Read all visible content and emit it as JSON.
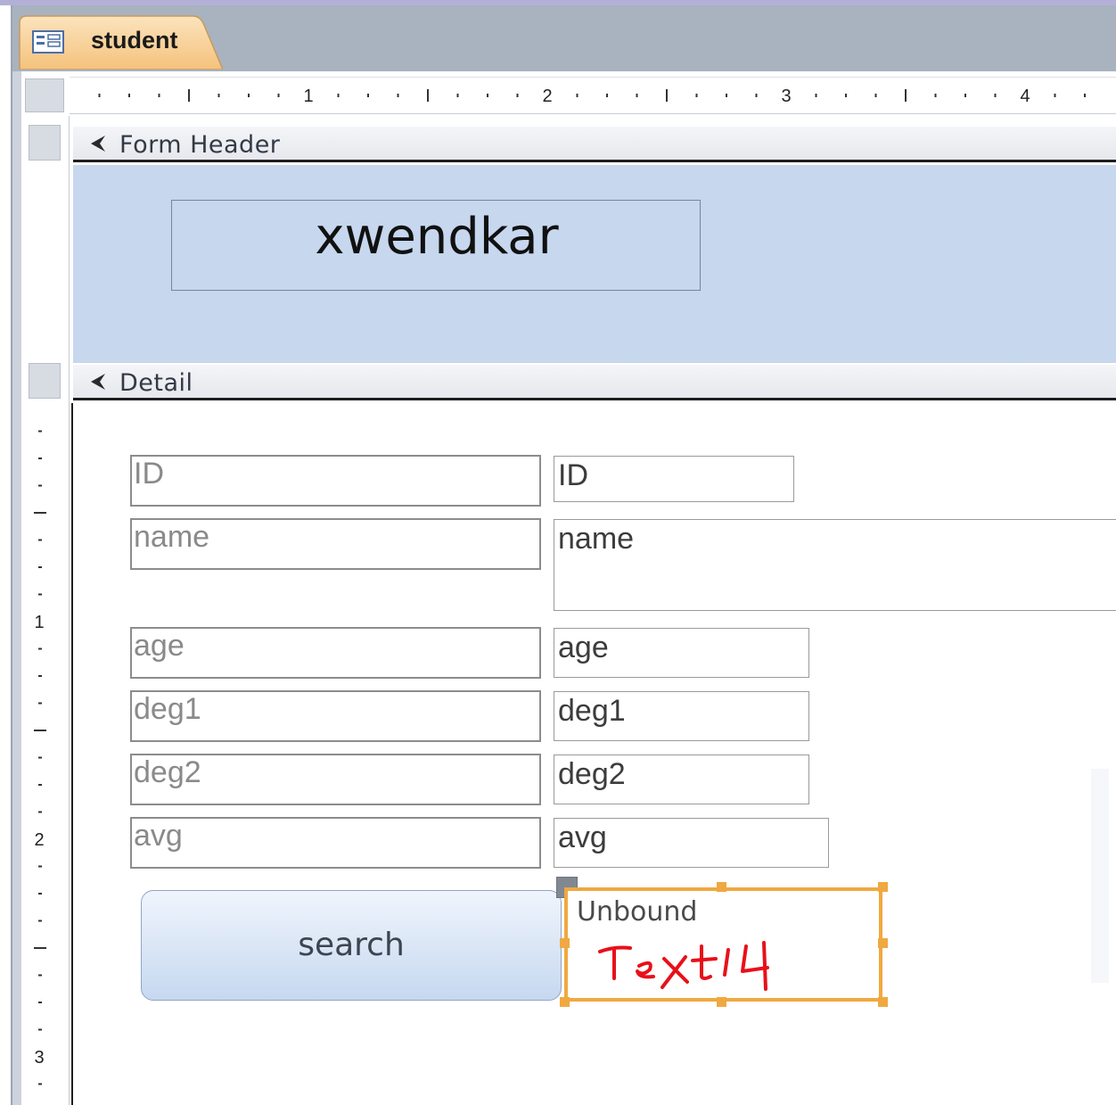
{
  "window": {
    "tab_label": "student",
    "tab_icon": "form-icon"
  },
  "ruler": {
    "horizontal_numbers": [
      "1",
      "2",
      "3",
      "4"
    ],
    "vertical_numbers": [
      "1",
      "2",
      "3"
    ]
  },
  "sections": {
    "form_header": "Form Header",
    "detail": "Detail"
  },
  "header": {
    "title": "xwendkar"
  },
  "fields": [
    {
      "label": "ID",
      "control": "ID"
    },
    {
      "label": "name",
      "control": "name"
    },
    {
      "label": "age",
      "control": "age"
    },
    {
      "label": "deg1",
      "control": "deg1"
    },
    {
      "label": "deg2",
      "control": "deg2"
    },
    {
      "label": "avg",
      "control": "avg"
    }
  ],
  "search_button": "search",
  "unbound_control": {
    "text": "Unbound",
    "annotation": "Text14",
    "highlight_color": "#f0a840",
    "annotation_color": "#e8101a"
  },
  "colors": {
    "header_background": "#c6d7ee",
    "tab_accent": "#f6c98a",
    "selection": "#f0a840"
  }
}
